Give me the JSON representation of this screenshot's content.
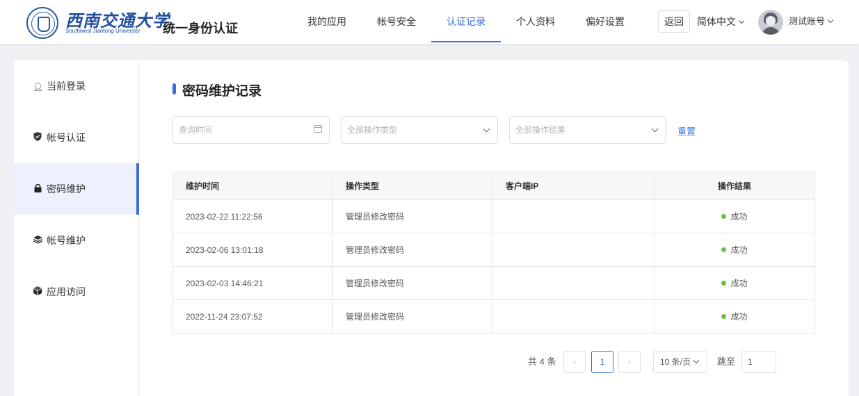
{
  "header": {
    "logo": {
      "cn": "西南交通大学",
      "en": "Southwest Jiaotong University"
    },
    "app_title": "统一身份认证",
    "nav": [
      {
        "label": "我的应用",
        "active": false
      },
      {
        "label": "帐号安全",
        "active": false
      },
      {
        "label": "认证记录",
        "active": true
      },
      {
        "label": "个人资料",
        "active": false
      },
      {
        "label": "偏好设置",
        "active": false
      }
    ],
    "back_label": "返回",
    "language": "简体中文",
    "user_name": "测试账号"
  },
  "sidebar": {
    "items": [
      {
        "label": "当前登录",
        "icon": "user-icon",
        "active": false
      },
      {
        "label": "帐号认证",
        "icon": "shield-icon",
        "active": false
      },
      {
        "label": "密码维护",
        "icon": "lock-icon",
        "active": true
      },
      {
        "label": "帐号维护",
        "icon": "layers-icon",
        "active": false
      },
      {
        "label": "应用访问",
        "icon": "cube-icon",
        "active": false
      }
    ]
  },
  "main": {
    "title": "密码维护记录",
    "filters": {
      "date_placeholder": "查询时间",
      "type_placeholder": "全部操作类型",
      "result_placeholder": "全部操作结果",
      "reset_label": "重置"
    },
    "table": {
      "columns": [
        "维护时间",
        "操作类型",
        "客户端IP",
        "操作结果"
      ],
      "rows": [
        {
          "time": "2023-02-22 11:22:56",
          "type": "管理员修改密码",
          "ip": "",
          "result": "成功"
        },
        {
          "time": "2023-02-06 13:01:18",
          "type": "管理员修改密码",
          "ip": "",
          "result": "成功"
        },
        {
          "time": "2023-02-03 14:46:21",
          "type": "管理员修改密码",
          "ip": "",
          "result": "成功"
        },
        {
          "time": "2022-11-24 23:07:52",
          "type": "管理员修改密码",
          "ip": "",
          "result": "成功"
        }
      ]
    },
    "pagination": {
      "total_text": "共 4 条",
      "prev": "‹",
      "next": "›",
      "current_page": "1",
      "page_size": "10 条/页",
      "jump_label": "跳至",
      "jump_value": "1"
    }
  },
  "colors": {
    "accent": "#3b6fd8",
    "success": "#67c23a"
  }
}
